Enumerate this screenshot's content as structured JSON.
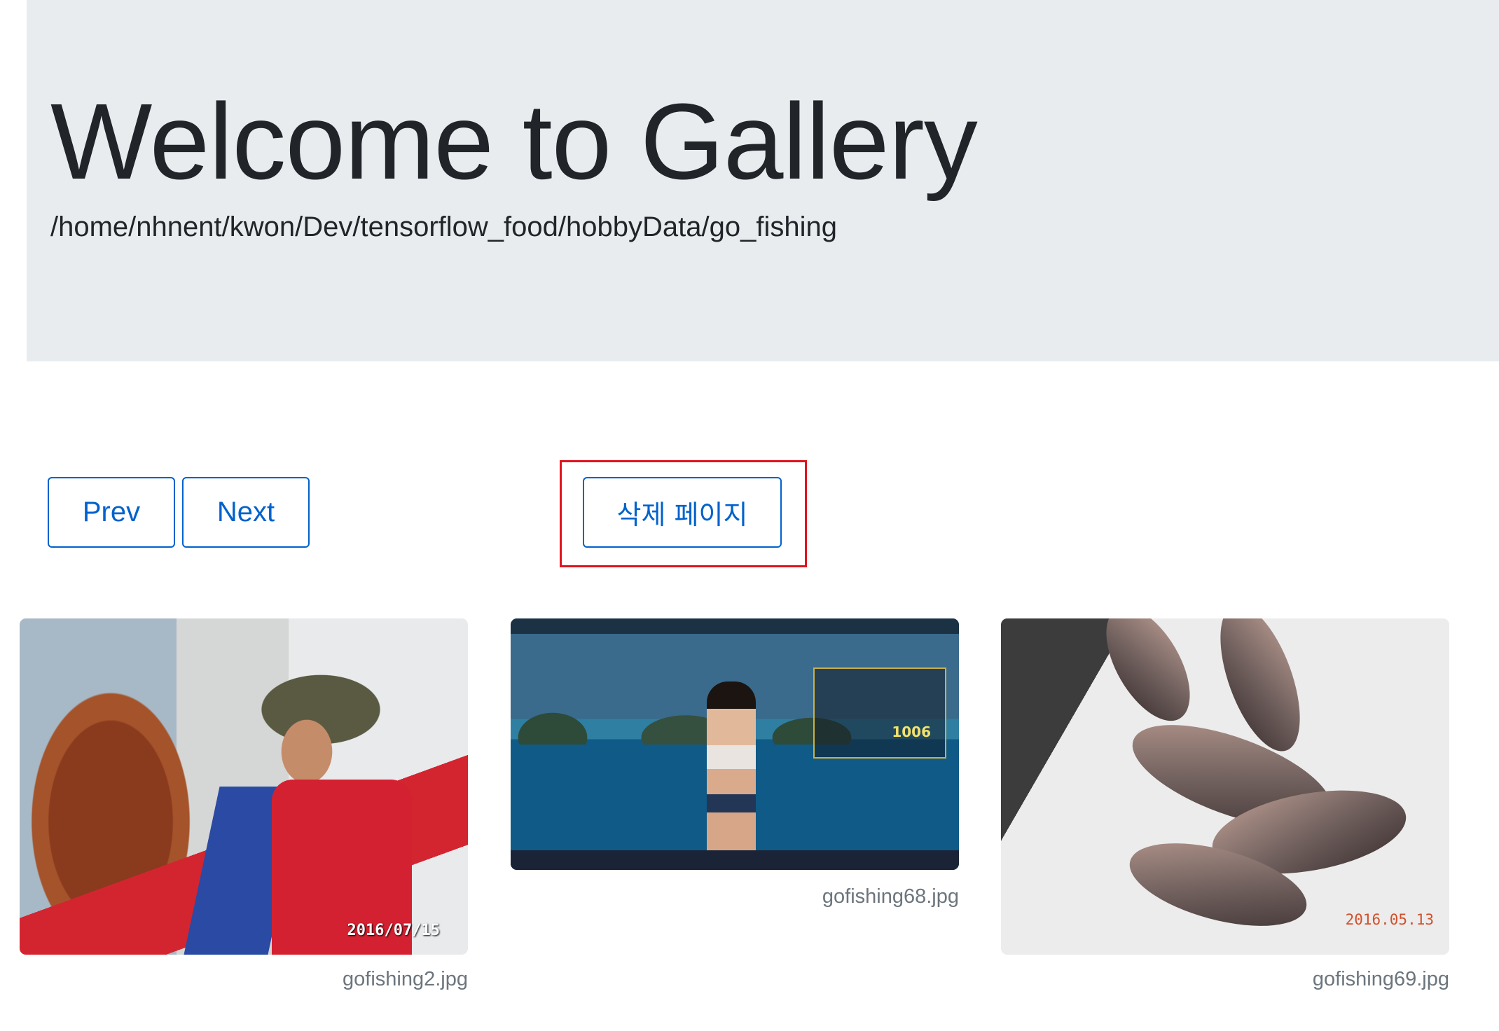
{
  "header": {
    "title": "Welcome to Gallery",
    "path": "/home/nhnent/kwon/Dev/tensorflow_food/hobbyData/go_fishing"
  },
  "nav": {
    "prev_label": "Prev",
    "next_label": "Next",
    "delete_label": "삭제 페이지"
  },
  "gallery": [
    {
      "filename": "gofishing2.jpg",
      "date_stamp": "2016/07/15"
    },
    {
      "filename": "gofishing68.jpg",
      "hud_score": "1006"
    },
    {
      "filename": "gofishing69.jpg",
      "date_stamp": "2016.05.13"
    }
  ],
  "colors": {
    "jumbotron_bg": "#e9ecef",
    "button_primary": "#0062cc",
    "highlight_box": "#e0141e"
  }
}
